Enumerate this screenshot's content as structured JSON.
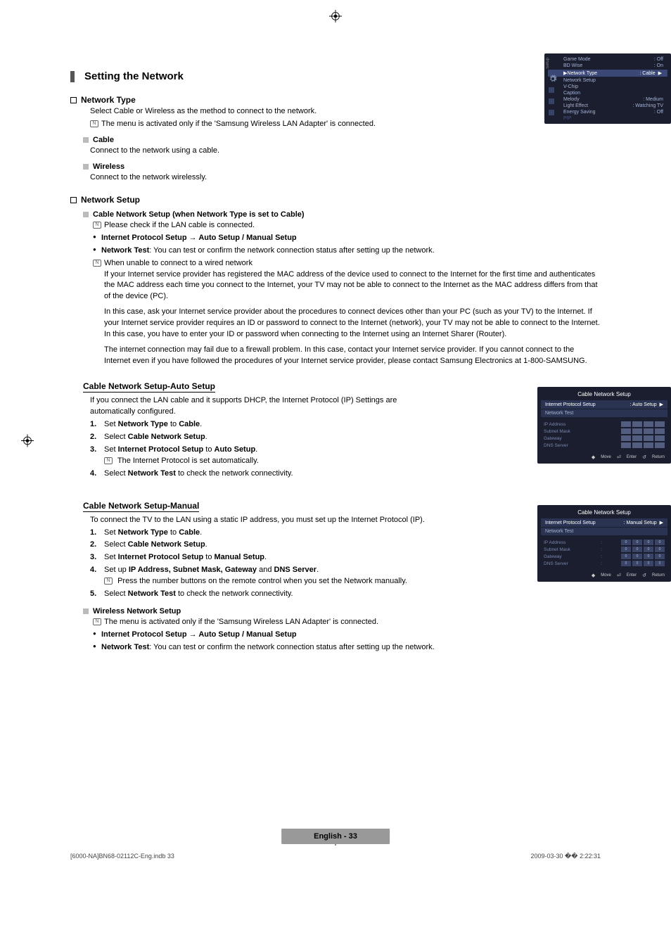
{
  "section_title": "Setting the Network",
  "h2_network_type": "Network Type",
  "nt_body": "Select Cable or Wireless as the method to connect to the network.",
  "nt_note": "The menu is activated only if the 'Samsung Wireless LAN Adapter' is connected.",
  "h3_cable": "Cable",
  "cable_body": "Connect to the network using a cable.",
  "h3_wireless": "Wireless",
  "wireless_body": "Connect to the network wirelessly.",
  "h2_network_setup": "Network Setup",
  "cns_line_prefix": "Cable Network Setup",
  "cns_line_mid": " (when ",
  "cns_line_nt": "Network Type",
  "cns_line_setto": " is set to ",
  "cns_line_cable": "Cable",
  "cns_line_end": ")",
  "cns_note1": "Please check if the LAN cable is connected.",
  "cns_b1_a": "Internet Protocol Setup → Auto Setup / Manual Setup",
  "cns_b2_a": "Network Test",
  "cns_b2_b": ": You can test or confirm the network connection status after setting up the network.",
  "cns_note2": "When unable to connect to a wired network",
  "para1": "If your Internet service provider has registered the MAC address of the device used to connect to the Internet for the first time and authenticates the MAC address each time you connect to the Internet, your TV may not be able to connect to the Internet as the MAC address differs from that of the device (PC).",
  "para2": "In this case, ask your Internet service provider about the procedures to connect devices other than your PC (such as your TV) to the Internet. If your Internet service provider requires an ID or password to connect to the Internet (network), your TV may not be able to connect to the Internet. In this case, you have to enter your ID or password when connecting to the Internet using an Internet Sharer (Router).",
  "para3": "The internet connection may fail due to a firewall problem. In this case, contact your Internet service provider. If you cannot connect to the Internet even if you have followed the procedures of your Internet service provider, please contact Samsung Electronics at 1-800-SAMSUNG.",
  "auto_title": "Cable Network Setup-Auto Setup",
  "auto_intro": "If you connect the LAN cable and it supports DHCP, the Internet Protocol (IP) Settings are automatically configured.",
  "auto_s1_a": "Set ",
  "auto_s1_b": "Network Type",
  "auto_s1_c": " to ",
  "auto_s1_d": "Cable",
  "auto_s1_e": ".",
  "auto_s2_a": "Select ",
  "auto_s2_b": "Cable Network Setup",
  "auto_s2_c": ".",
  "auto_s3_a": "Set ",
  "auto_s3_b": "Internet Protocol Setup",
  "auto_s3_c": " to ",
  "auto_s3_d": "Auto Setup",
  "auto_s3_e": ".",
  "auto_s3_note": "The Internet Protocol is set automatically.",
  "auto_s4_a": "Select ",
  "auto_s4_b": "Network Test",
  "auto_s4_c": " to check the network connectivity.",
  "man_title": "Cable Network Setup-Manual",
  "man_intro": "To connect the TV to the LAN using a static IP address, you must set up the Internet Protocol (IP).",
  "man_s1_a": "Set ",
  "man_s1_b": "Network Type",
  "man_s1_c": " to ",
  "man_s1_d": "Cable",
  "man_s1_e": ".",
  "man_s2_a": "Select ",
  "man_s2_b": "Cable Network Setup",
  "man_s2_c": ".",
  "man_s3_a": "Set ",
  "man_s3_b": "Internet Protocol Setup",
  "man_s3_c": " to ",
  "man_s3_d": "Manual Setup",
  "man_s3_e": ".",
  "man_s4_a": "Set up ",
  "man_s4_b": "IP Address, Subnet Mask, Gateway",
  "man_s4_c": " and ",
  "man_s4_d": "DNS Server",
  "man_s4_e": ".",
  "man_s4_note": "Press the number buttons on the remote control when you set the Network manually.",
  "man_s5_a": "Select ",
  "man_s5_b": "Network Test",
  "man_s5_c": " to check the network connectivity.",
  "wns_title": "Wireless Network Setup",
  "wns_note": "The menu is activated only if the 'Samsung Wireless LAN Adapter' is connected.",
  "wns_b1": "Internet Protocol Setup → Auto Setup / Manual Setup",
  "wns_b2_a": "Network Test",
  "wns_b2_b": ": You can test or confirm the network connection status after setting up the network.",
  "page_label": "English - 33",
  "footer_left": "[6000-NA]BN68-02112C-Eng.indb   33",
  "footer_right": "2009-03-30   �� 2:22:31",
  "osd1": {
    "vert": "Setup",
    "r1_l": "Game Mode",
    "r1_v": ": Off",
    "r2_l": "BD Wise",
    "r2_v": ": On",
    "r3_l": "▶Network Type",
    "r3_v": ": Cable",
    "r4_l": "Network Setup",
    "r5_l": "V-Chip",
    "r6_l": "Caption",
    "r7_l": "Melody",
    "r7_v": ": Medium",
    "r8_l": "Light Effect",
    "r8_v": ": Watching TV",
    "r9_l": "Energy Saving",
    "r9_v": ": Off",
    "r10_l": "PIP"
  },
  "osd2": {
    "title": "Cable Network Setup",
    "row1_l": "Internet Protocol Setup",
    "row1_v": ": Auto Setup",
    "row2_l": "Network Test",
    "ip_l": "IP Address",
    "sm_l": "Subnet Mask",
    "gw_l": "Gateway",
    "dns_l": "DNS Server",
    "f_move": "Move",
    "f_enter": "Enter",
    "f_return": "Return"
  },
  "osd3": {
    "title": "Cable Network Setup",
    "row1_l": "Internet Protocol Setup",
    "row1_v": ": Manual Setup",
    "row2_l": "Network Test",
    "ip_l": "IP Address",
    "sm_l": "Subnet Mask",
    "gw_l": "Gateway",
    "dns_l": "DNS Server",
    "v": "0",
    "f_move": "Move",
    "f_enter": "Enter",
    "f_return": "Return"
  }
}
